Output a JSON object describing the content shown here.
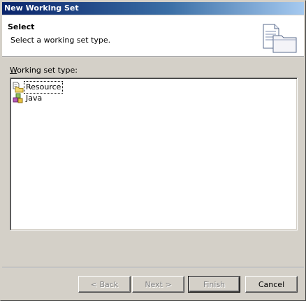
{
  "window": {
    "title": "New Working Set"
  },
  "header": {
    "title": "Select",
    "description": "Select a working set type.",
    "icon": "working-set-wizard-icon"
  },
  "field": {
    "label_mnemonic": "W",
    "label_rest": "orking set type:"
  },
  "list": {
    "items": [
      {
        "label": "Resource",
        "icon": "resource-folder-icon",
        "selected": true
      },
      {
        "label": "Java",
        "icon": "java-package-icon",
        "selected": false
      }
    ]
  },
  "buttons": {
    "back": "< Back",
    "back_mnemonic": "B",
    "next": "Next >",
    "next_mnemonic": "N",
    "finish": "Finish",
    "finish_mnemonic": "F",
    "cancel": "Cancel"
  }
}
